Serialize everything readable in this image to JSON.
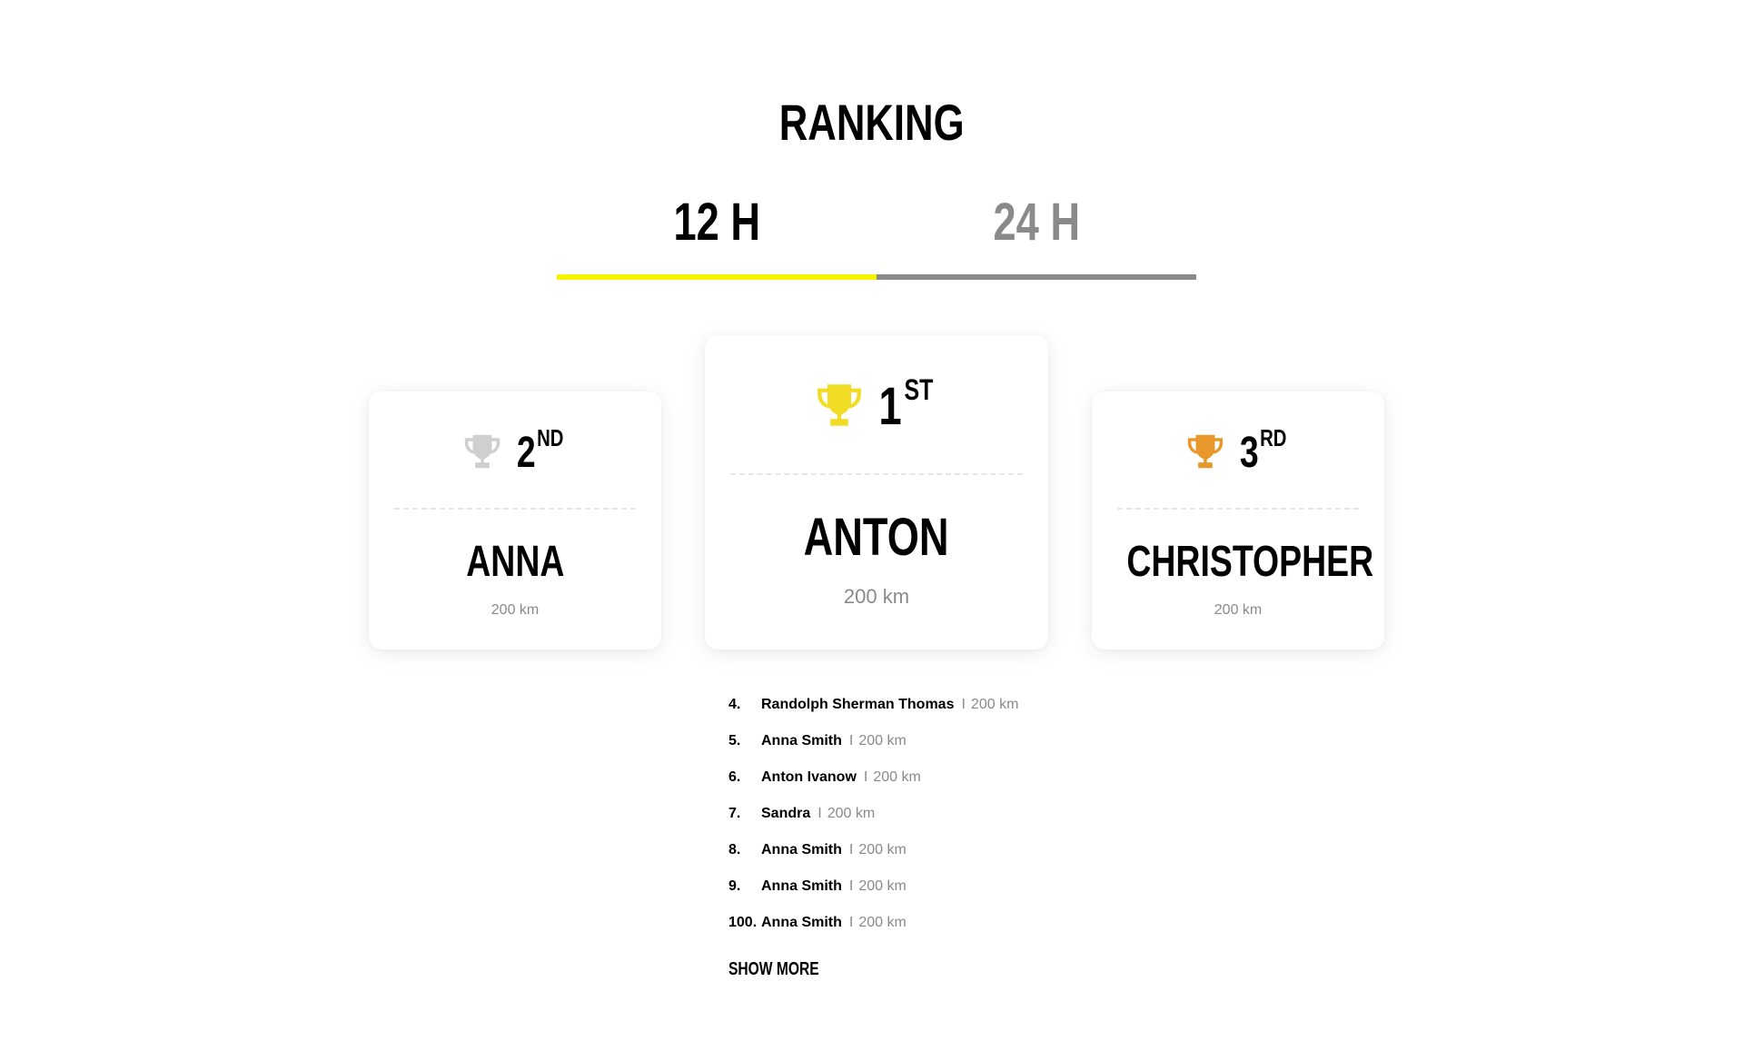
{
  "page": {
    "title": "RANKING"
  },
  "tabs": [
    {
      "label": "12 H",
      "active": true
    },
    {
      "label": "24 H",
      "active": false
    }
  ],
  "colors": {
    "accent": "#f5f500",
    "inactive": "#8a8a8a",
    "gold": "#f2dd26",
    "silver": "#cfcfcf",
    "bronze": "#e8982b"
  },
  "podium": {
    "first": {
      "place": "1",
      "suffix": "ST",
      "name": "ANTON",
      "distance": "200 km",
      "icon": "trophy-gold-icon"
    },
    "second": {
      "place": "2",
      "suffix": "ND",
      "name": "ANNA",
      "distance": "200 km",
      "icon": "trophy-silver-icon"
    },
    "third": {
      "place": "3",
      "suffix": "RD",
      "name": "CHRISTOPHER",
      "distance": "200 km",
      "icon": "trophy-bronze-icon"
    }
  },
  "ranking": [
    {
      "num": "4.",
      "name": "Randolph Sherman Thomas",
      "sep": "I",
      "distance": "200 km"
    },
    {
      "num": "5.",
      "name": "Anna Smith",
      "sep": "I",
      "distance": "200 km"
    },
    {
      "num": "6.",
      "name": "Anton Ivanow",
      "sep": "I",
      "distance": "200 km"
    },
    {
      "num": "7.",
      "name": "Sandra",
      "sep": "I",
      "distance": "200 km"
    },
    {
      "num": "8.",
      "name": "Anna Smith",
      "sep": "I",
      "distance": "200 km"
    },
    {
      "num": "9.",
      "name": "Anna Smith",
      "sep": "I",
      "distance": "200 km"
    },
    {
      "num": "100.",
      "name": "Anna Smith",
      "sep": "I",
      "distance": "200 km"
    }
  ],
  "show_more_label": "SHOW MORE"
}
